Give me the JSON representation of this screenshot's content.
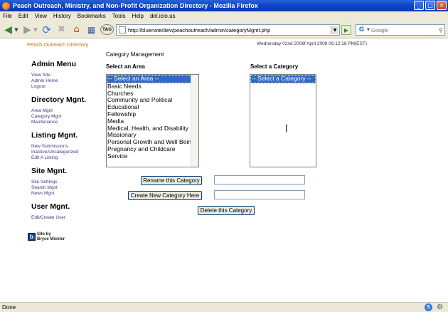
{
  "window": {
    "title": "Peach Outreach, Ministry, and Non-Profit Organization Directory - Mozilla Firefox",
    "min_glyph": "_",
    "max_glyph": "□",
    "close_glyph": "×"
  },
  "menubar": {
    "items": [
      "File",
      "Edit",
      "View",
      "History",
      "Bookmarks",
      "Tools",
      "Help",
      "del.icio.us"
    ]
  },
  "toolbar": {
    "url": "http://bluenote/dev/peachoutreach/admin/categoryMgmt.php",
    "search_placeholder": "Google",
    "tag_label": "TAG"
  },
  "header": {
    "site_name": "Peach Outreach Directory",
    "datetime": "Wednesday 02nd 2008f April 2008 06:12:18 PM(EST)"
  },
  "sidebar": {
    "sections": [
      {
        "heading": "Admin Menu",
        "links": [
          "View Site",
          "Admin Home",
          "Logout"
        ]
      },
      {
        "heading": "Directory Mgnt.",
        "links": [
          "Area Mgnt",
          "Category Mgnt",
          "Maintenance"
        ]
      },
      {
        "heading": "Listing Mgnt.",
        "links": [
          "New Submissions",
          "Inactive/Uncategorized",
          "Edit A Listing"
        ]
      },
      {
        "heading": "Site Mgnt.",
        "links": [
          "Site Settings",
          "Search Mgnt",
          "News Mgnt"
        ]
      },
      {
        "heading": "User Mgnt.",
        "links": [
          "Edit/Create User"
        ]
      }
    ],
    "credit_logo": "b",
    "credit_line1": "Site by",
    "credit_line2": "Bryce Mickler"
  },
  "main": {
    "heading": "Category Management",
    "area_label": "Select an Area",
    "category_label": "Select a Category",
    "area_options": [
      "-- Select an Area --",
      "Basic Needs",
      "Churches",
      "Community and Political",
      "Educational",
      "Fellowship",
      "Media",
      "Medical, Health, and Disability",
      "Missionary",
      "Personal Growth and Well Being",
      "Pregnancy and Childcare",
      "Service"
    ],
    "category_options": [
      "-- Select a Category --"
    ],
    "rename_button": "Rename this Category",
    "create_button": "Create New Category Here",
    "delete_button": "Delete this Category",
    "rename_value": "",
    "create_value": ""
  },
  "status": {
    "text": "Done"
  }
}
